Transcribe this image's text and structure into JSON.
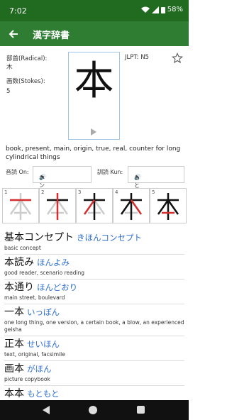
{
  "status": {
    "time": "7:02",
    "battery": "58%"
  },
  "appbar": {
    "title": "漢字辞書"
  },
  "info": {
    "radical_label": "部首(Radical):",
    "radical_value": "木",
    "strokes_label": "画数(Stokes):",
    "strokes_value": "5",
    "jlpt": "JLPT: N5"
  },
  "kanji": {
    "character": "本"
  },
  "meaning": "book, present, main, origin, true, real, counter for long cylindrical things",
  "readings": {
    "on_label": "音読 On:",
    "on_value": "ホン",
    "kun_label": "訓読 Kun:",
    "kun_value": "もと"
  },
  "stroke_order": [
    {
      "num": "1"
    },
    {
      "num": "2"
    },
    {
      "num": "3"
    },
    {
      "num": "4"
    },
    {
      "num": "5"
    }
  ],
  "words": [
    {
      "kanji": "基本コンセプト",
      "kana": "きほんコンセプト",
      "def": "basic concept"
    },
    {
      "kanji": "本読み",
      "kana": "ほんよみ",
      "def": "good reader, scenario reading"
    },
    {
      "kanji": "本通り",
      "kana": "ほんどおり",
      "def": "main street, boulevard"
    },
    {
      "kanji": "一本",
      "kana": "いっぽん",
      "def": "one long thing, one version, a certain book, a blow, an experienced geisha"
    },
    {
      "kanji": "正本",
      "kana": "せいほん",
      "def": "text, original, facsimile"
    },
    {
      "kanji": "画本",
      "kana": "がほん",
      "def": "picture copybook"
    },
    {
      "kanji": "本本",
      "kana": "もともと",
      "def": ""
    }
  ],
  "colors": {
    "primary": "#2e7d32",
    "status_bar": "#216b21",
    "kana": "#2f6fd0",
    "stroke_highlight": "#d32f2f"
  }
}
